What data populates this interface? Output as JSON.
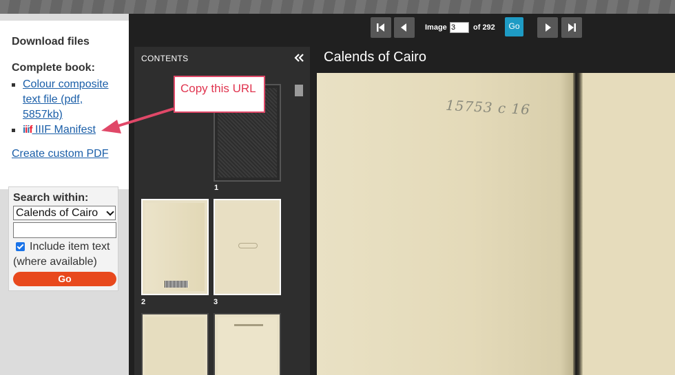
{
  "sidebar": {
    "download_title": "Download files",
    "complete_book": "Complete book:",
    "files": [
      {
        "label": "Colour composite text file (pdf, 5857kb)"
      },
      {
        "label": " IIIF Manifest",
        "logo": "iiif"
      }
    ],
    "custom_pdf": "Create custom PDF",
    "search": {
      "title": "Search within:",
      "scope": "Calends of Cairo",
      "query": "",
      "include_label": "Include item text",
      "include_note": "(where available)",
      "include_checked": true,
      "go": "Go"
    }
  },
  "toolbar": {
    "image_label": "Image",
    "image_value": "3",
    "of_total": "of 292",
    "go": "Go",
    "icons": [
      "first-page-icon",
      "prev-page-icon",
      "next-page-icon",
      "last-page-icon"
    ]
  },
  "contents": {
    "title": "CONTENTS",
    "thumbnails": [
      {
        "num": "1",
        "kind": "cover"
      },
      {
        "num": "2",
        "kind": "page",
        "selected": true
      },
      {
        "num": "3",
        "kind": "page",
        "selected": true
      },
      {
        "num": "",
        "kind": "page"
      },
      {
        "num": "",
        "kind": "page"
      }
    ]
  },
  "page": {
    "title": "Calends of Cairo",
    "pencil_note": "15753 c 16"
  },
  "annotation": {
    "text": "Copy this URL",
    "color": "#e0344f"
  }
}
